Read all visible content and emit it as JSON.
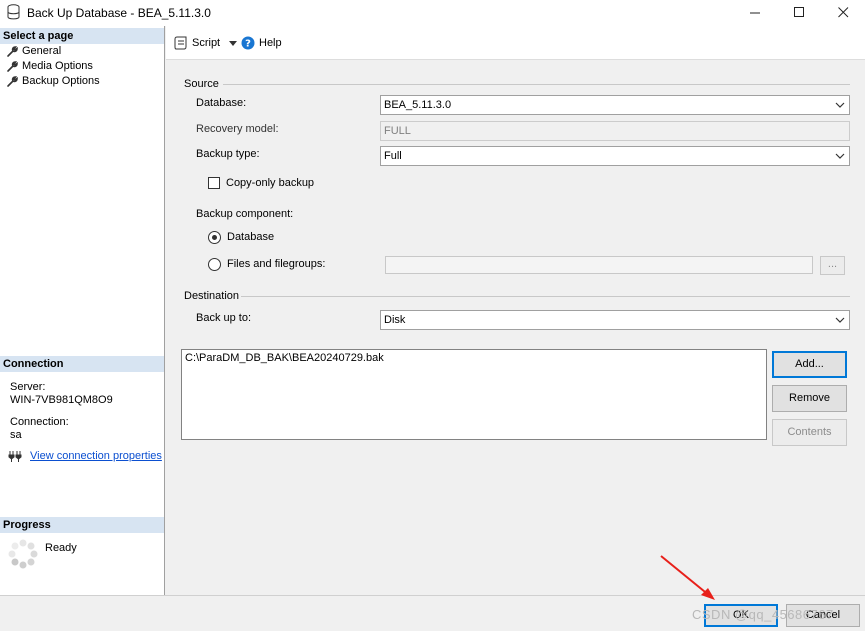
{
  "window": {
    "title": "Back Up Database - BEA_5.11.3.0",
    "controls": [
      "minimize",
      "maximize",
      "close"
    ]
  },
  "left_pane": {
    "select_page_header": "Select a page",
    "pages": [
      {
        "label": "General",
        "icon": "wrench-icon",
        "selected": true
      },
      {
        "label": "Media Options",
        "icon": "wrench-icon",
        "selected": false
      },
      {
        "label": "Backup Options",
        "icon": "wrench-icon",
        "selected": false
      }
    ],
    "connection_header": "Connection",
    "server_label": "Server:",
    "server_value": "WIN-7VB981QM8O9",
    "connection_label": "Connection:",
    "connection_value": "sa",
    "view_connection_link": "View connection properties",
    "progress_header": "Progress",
    "progress_status": "Ready"
  },
  "toolbar": {
    "script_label": "Script",
    "help_label": "Help"
  },
  "source": {
    "group_label": "Source",
    "database_label": "Database:",
    "database_value": "BEA_5.11.3.0",
    "recovery_label": "Recovery model:",
    "recovery_value": "FULL",
    "backup_type_label": "Backup type:",
    "backup_type_value": "Full",
    "copy_only_label": "Copy-only backup",
    "copy_only_checked": false,
    "component_label": "Backup component:",
    "component_database_label": "Database",
    "component_files_label": "Files and filegroups:",
    "component_selected": "Database",
    "files_browse_label": "..."
  },
  "destination": {
    "group_label": "Destination",
    "back_up_to_label": "Back up to:",
    "back_up_to_value": "Disk",
    "paths": [
      "C:\\ParaDM_DB_BAK\\BEA20240729.bak"
    ],
    "add_label": "Add...",
    "remove_label": "Remove",
    "contents_label": "Contents"
  },
  "footer": {
    "ok_label": "OK",
    "cancel_label": "Cancel",
    "watermark": "CSDN @qq_45686767"
  },
  "colors": {
    "section_header_bg": "#d7e4f2",
    "link": "#0b4fd0",
    "default_button_border": "#0078d7",
    "annotation_arrow": "#e8201a"
  }
}
